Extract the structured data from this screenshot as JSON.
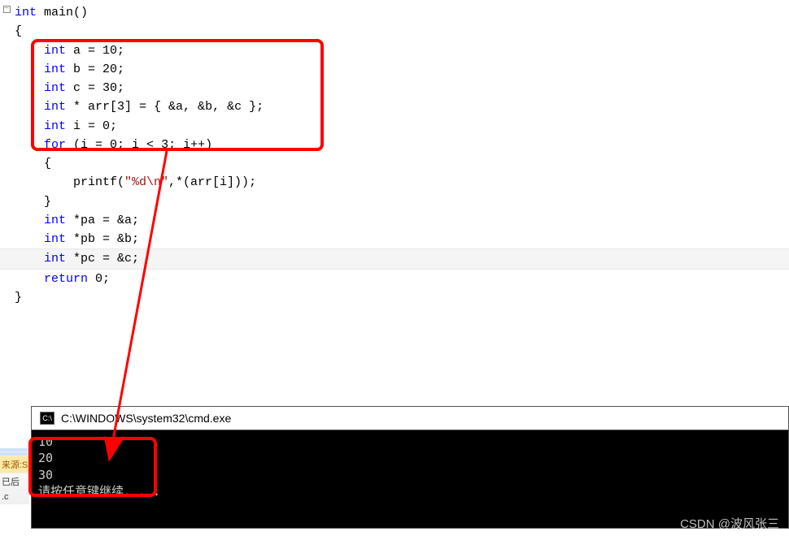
{
  "code": {
    "fold_sym": "−",
    "l1a": "int",
    "l1b": " main()",
    "l2": "{",
    "l3a": "    int",
    "l3b": " a = ",
    "l3c": "10",
    "l3d": ";",
    "l4a": "    int",
    "l4b": " b = ",
    "l4c": "20",
    "l4d": ";",
    "l5a": "    int",
    "l5b": " c = ",
    "l5c": "30",
    "l5d": ";",
    "l6": "",
    "l7a": "    int",
    "l7b": " * arr[",
    "l7c": "3",
    "l7d": "] = { &a, &b, &c };",
    "l8a": "    int",
    "l8b": " i = ",
    "l8c": "0",
    "l8d": ";",
    "l9a": "    for",
    "l9b": " (i = ",
    "l9c": "0",
    "l9d": "; i < ",
    "l9e": "3",
    "l9f": "; i++)",
    "l10": "    {",
    "l11a": "        printf(",
    "l11b": "\"%d\\n\"",
    "l11c": ",*(arr[i]));",
    "l12": "    }",
    "l13": "",
    "l14a": "    int",
    "l14b": " *pa = &a;",
    "l15a": "    int",
    "l15b": " *pb = &b;",
    "l16a": "    int",
    "l16b": " *pc = &c;",
    "l17": "",
    "l18a": "    return",
    "l18b": " ",
    "l18c": "0",
    "l18d": ";",
    "l19": "}"
  },
  "console": {
    "icon_text": "C:\\",
    "title": "C:\\WINDOWS\\system32\\cmd.exe",
    "out1": "10",
    "out2": "20",
    "out3": "30",
    "out4": "请按任意键继续. . ."
  },
  "sidebar": {
    "i1": "",
    "i2": "",
    "i3": "来源:S",
    "i4": "已后",
    "i5": ".c"
  },
  "watermark": "CSDN @波风张三",
  "colors": {
    "highlight": "#ff0000",
    "keyword": "#0000ff",
    "string": "#a31515"
  }
}
